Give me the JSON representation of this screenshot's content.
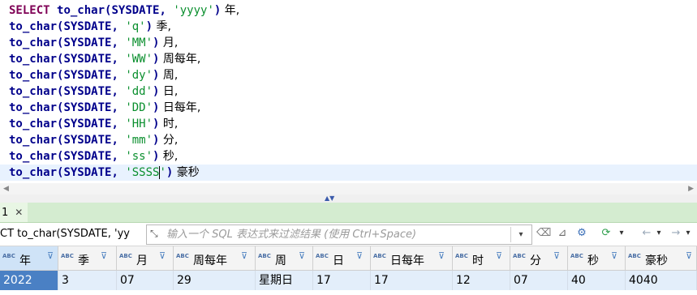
{
  "editor": {
    "line1": {
      "kw": "SELECT",
      "fn": "to_char",
      "arg": "(SYSDATE, ",
      "str": "'yyyy'",
      "close": ")",
      "alias": " 年,"
    },
    "line2": {
      "fn": "to_char",
      "arg": "(SYSDATE, ",
      "str": "'q'",
      "close": ")",
      "alias": " 季,"
    },
    "line3": {
      "fn": "to_char",
      "arg": "(SYSDATE, ",
      "str": "'MM'",
      "close": ")",
      "alias": " 月,"
    },
    "line4": {
      "fn": "to_char",
      "arg": "(SYSDATE, ",
      "str": "'WW'",
      "close": ")",
      "alias": " 周每年,"
    },
    "line5": {
      "fn": "to_char",
      "arg": "(SYSDATE, ",
      "str": "'dy'",
      "close": ")",
      "alias": " 周,"
    },
    "line6": {
      "fn": "to_char",
      "arg": "(SYSDATE, ",
      "str": "'dd'",
      "close": ")",
      "alias": " 日,"
    },
    "line7": {
      "fn": "to_char",
      "arg": "(SYSDATE, ",
      "str": "'DD'",
      "close": ")",
      "alias": " 日每年,"
    },
    "line8": {
      "fn": "to_char",
      "arg": "(SYSDATE, ",
      "str": "'HH'",
      "close": ")",
      "alias": " 时,"
    },
    "line9": {
      "fn": "to_char",
      "arg": "(SYSDATE, ",
      "str": "'mm'",
      "close": ")",
      "alias": " 分,"
    },
    "line10": {
      "fn": "to_char",
      "arg": "(SYSDATE, ",
      "str": "'ss'",
      "close": ")",
      "alias": " 秒,"
    },
    "line11": {
      "fn": "to_char",
      "arg": "(SYSDATE, ",
      "str_a": "'SSSS",
      "str_b": "'",
      "close": ")",
      "alias": " 豪秒"
    }
  },
  "result_tab": {
    "label": "1",
    "close": "✕"
  },
  "filter": {
    "query_text": "CT to_char(SYSDATE, 'yy",
    "placeholder": "输入一个 SQL 表达式来过滤结果 (使用 Ctrl+Space)",
    "expand_icon": "⤡",
    "dropdown_icon": "▾"
  },
  "toolbar_icons": {
    "eraser": "⌫",
    "funnel": "⊿",
    "gear": "⚙",
    "refresh": "⟳",
    "prev": "←",
    "next": "→",
    "more": "▾"
  },
  "grid": {
    "type_badge": "ABC",
    "filter_glyph": "⊽",
    "columns": [
      "年",
      "季",
      "月",
      "周每年",
      "周",
      "日",
      "日每年",
      "时",
      "分",
      "秒",
      "豪秒"
    ],
    "row": [
      "2022",
      "3",
      "07",
      "29",
      "星期日",
      "17",
      "17",
      "12",
      "07",
      "40",
      "4040"
    ]
  },
  "colors": {
    "keyword": "#7f0055",
    "function": "#00008b",
    "string": "#0a8f2e",
    "tab_green": "#d4ecd0",
    "selected_cell": "#4a80c4"
  }
}
